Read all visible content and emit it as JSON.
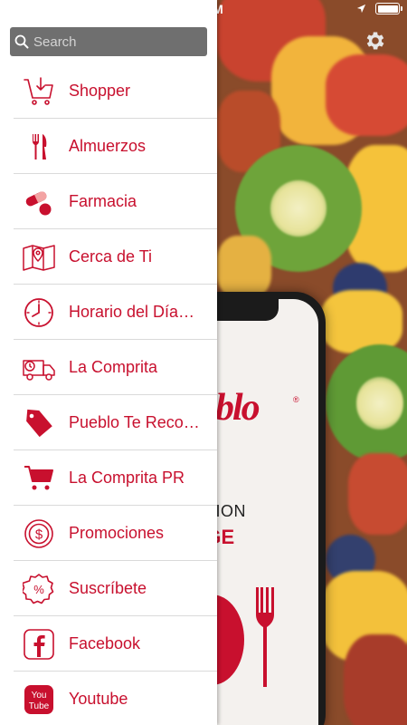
{
  "status_bar": {
    "time": "AM"
  },
  "theme": {
    "accent": "#c8102e",
    "drawer_bg": "#ffffff",
    "search_bg": "#6f6f6f",
    "separator": "#dadada"
  },
  "search": {
    "placeholder": "Search",
    "value": ""
  },
  "menu": {
    "items": [
      {
        "label": "Shopper",
        "icon": "shopping-cart-download-icon"
      },
      {
        "label": "Almuerzos",
        "icon": "fork-knife-icon"
      },
      {
        "label": "Farmacia",
        "icon": "pill-icon"
      },
      {
        "label": "Cerca de Ti",
        "icon": "map-pin-icon"
      },
      {
        "label": "Horario del Día…",
        "icon": "clock-icon"
      },
      {
        "label": "La Comprita",
        "icon": "delivery-truck-icon"
      },
      {
        "label": "Pueblo Te Reco…",
        "icon": "tag-icon"
      },
      {
        "label": "La Comprita PR",
        "icon": "shopping-cart-icon"
      },
      {
        "label": "Promociones",
        "icon": "dollar-coin-icon"
      },
      {
        "label": "Suscríbete",
        "icon": "percent-badge-icon"
      },
      {
        "label": "Facebook",
        "icon": "facebook-icon"
      },
      {
        "label": "Youtube",
        "icon": "youtube-icon"
      }
    ]
  },
  "background_phone": {
    "logo_text": "blo",
    "line1": "OPCION",
    "line2": "LAGE"
  }
}
